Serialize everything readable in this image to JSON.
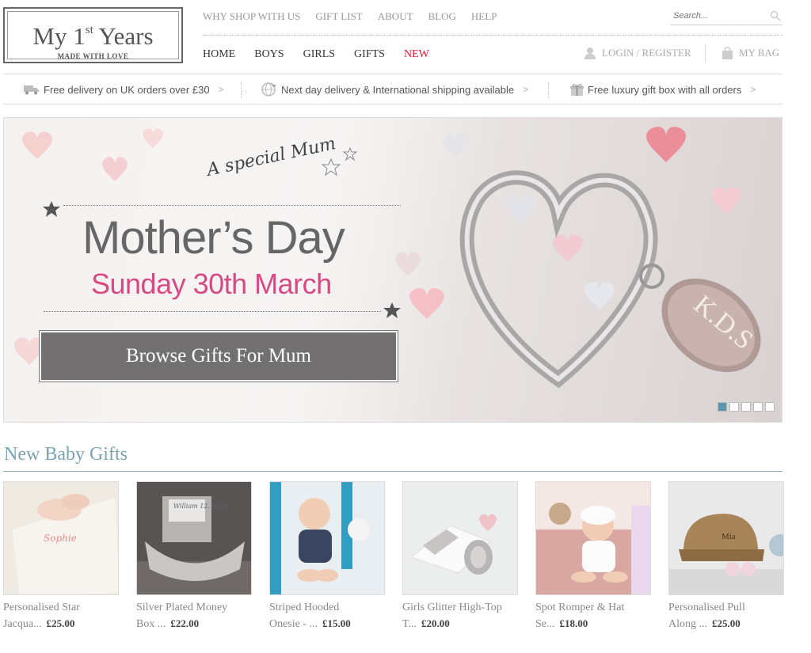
{
  "logo": {
    "title_prefix": "My 1",
    "title_sup": "st",
    "title_suffix": " Years",
    "tagline": "MADE WITH LOVE"
  },
  "top_nav": [
    "WHY SHOP WITH US",
    "GIFT LIST",
    "ABOUT",
    "BLOG",
    "HELP"
  ],
  "search": {
    "placeholder": "Search..."
  },
  "main_nav": [
    "HOME",
    "BOYS",
    "GIRLS",
    "GIFTS",
    "NEW"
  ],
  "account": {
    "login_label": "LOGIN / REGISTER",
    "bag_label": "MY BAG"
  },
  "benefits": [
    {
      "text": "Free delivery on UK orders over £30",
      "icon": "delivery-truck-icon"
    },
    {
      "text": "Next day delivery & International shipping available",
      "icon": "globe-plane-icon"
    },
    {
      "text": "Free luxury gift box with all orders",
      "icon": "gift-box-icon"
    }
  ],
  "hero": {
    "tagline": "A special Mum",
    "title": "Mother’s Day",
    "subtitle": "Sunday 30th March",
    "button_label": "Browse Gifts For Mum",
    "engraving": "K.D.S",
    "slides": 5,
    "active_slide": 1
  },
  "section": {
    "title": "New Baby Gifts"
  },
  "products": [
    {
      "name": "Personalised Star",
      "line2": "Jacqua...",
      "price": "£25.00",
      "image_text": "Sophie"
    },
    {
      "name": "Silver Plated Money",
      "line2": "Box ...",
      "price": "£22.00",
      "image_text": "William 12.10.13"
    },
    {
      "name": "Striped Hooded",
      "line2": "Onesie - ...",
      "price": "£15.00",
      "image_text": ""
    },
    {
      "name": "Girls Glitter High-Top",
      "line2": "T...",
      "price": "£20.00",
      "image_text": ""
    },
    {
      "name": "Spot Romper & Hat",
      "line2": "Se...",
      "price": "£18.00",
      "image_text": ""
    },
    {
      "name": "Personalised Pull",
      "line2": "Along ...",
      "price": "£25.00",
      "image_text": "Mia"
    }
  ],
  "colors": {
    "accent_teal": "#7aa3b2",
    "new_red": "#e0192c",
    "pink": "#d74a84",
    "button_grey": "#737071"
  }
}
